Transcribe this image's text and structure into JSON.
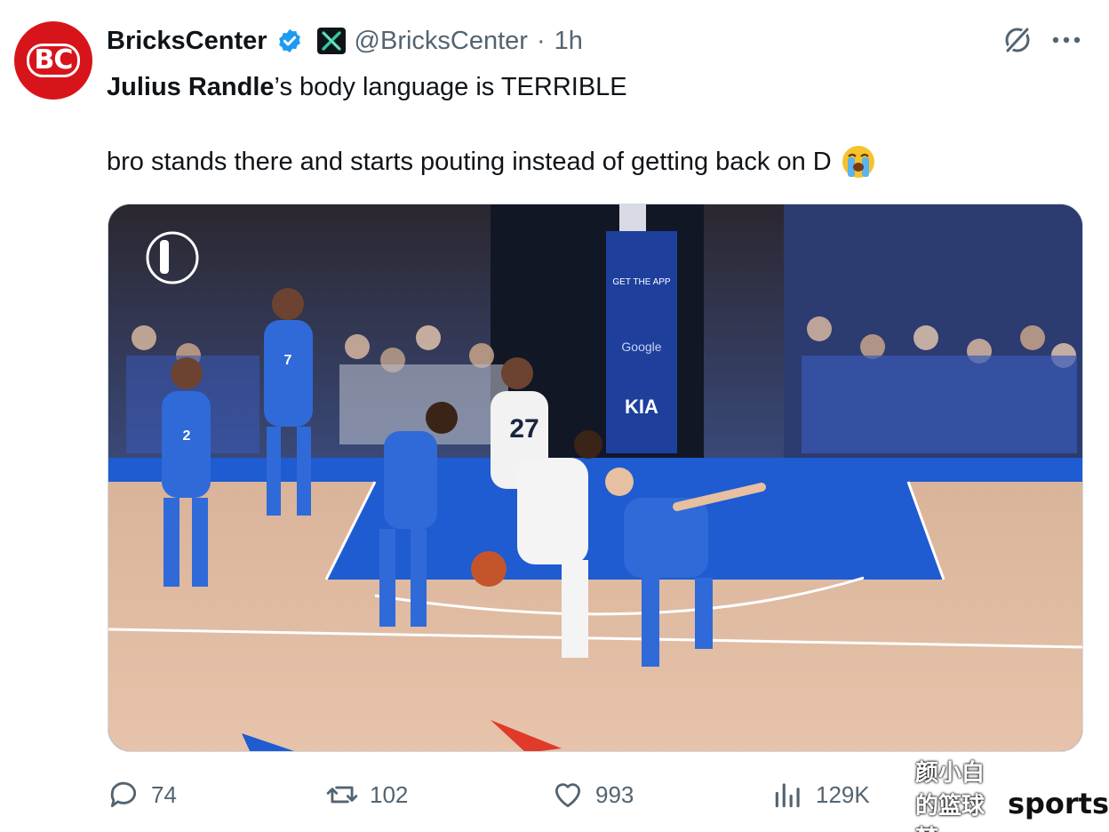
{
  "author": {
    "avatar_text": "BC",
    "display_name": "BricksCenter",
    "handle": "@BricksCenter",
    "separator": "·",
    "time": "1h"
  },
  "post": {
    "line1_bold": "Julius Randle",
    "line1_rest": "’s body language is TERRIBLE",
    "line2": "bro stands there and starts pouting instead of getting back on D",
    "emoji": "loudly-crying-face"
  },
  "media": {
    "jersey_numbers": [
      "27",
      "7",
      "2"
    ],
    "arena_signs": [
      "GET THE APP",
      "Google",
      "KIA"
    ]
  },
  "actions": {
    "replies": "74",
    "reposts": "102",
    "likes": "993",
    "views": "129K"
  },
  "watermark": {
    "chinese": "颜小白的篮球梦",
    "sports": "sports"
  },
  "colors": {
    "text": "#0f1419",
    "secondary": "#536471",
    "verified": "#1d9bf0",
    "avatar_red": "#d8141b",
    "court_blue": "#1f5bd1"
  }
}
